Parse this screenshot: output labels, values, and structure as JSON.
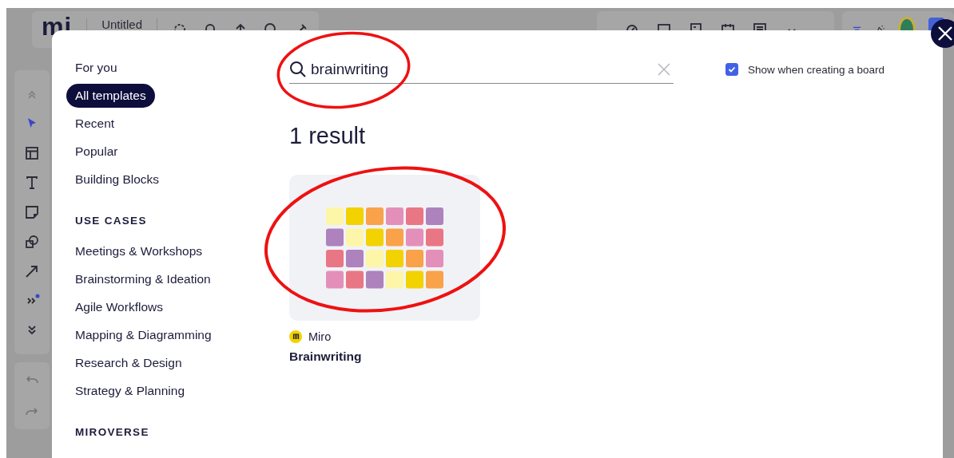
{
  "board": {
    "logo": "mi",
    "title": "Untitled"
  },
  "dialog": {
    "nav": [
      {
        "kind": "item",
        "label": "For you",
        "selected": false
      },
      {
        "kind": "item",
        "label": "All templates",
        "selected": true
      },
      {
        "kind": "item",
        "label": "Recent",
        "selected": false
      },
      {
        "kind": "item",
        "label": "Popular",
        "selected": false
      },
      {
        "kind": "item",
        "label": "Building Blocks",
        "selected": false
      },
      {
        "kind": "heading",
        "label": "USE CASES"
      },
      {
        "kind": "item",
        "label": "Meetings & Workshops",
        "selected": false
      },
      {
        "kind": "item",
        "label": "Brainstorming & Ideation",
        "selected": false
      },
      {
        "kind": "item",
        "label": "Agile Workflows",
        "selected": false
      },
      {
        "kind": "item",
        "label": "Mapping & Diagramming",
        "selected": false
      },
      {
        "kind": "item",
        "label": "Research & Design",
        "selected": false
      },
      {
        "kind": "item",
        "label": "Strategy & Planning",
        "selected": false
      },
      {
        "kind": "heading",
        "label": "MIROVERSE"
      }
    ],
    "search": {
      "value": "brainwriting"
    },
    "show_when_creating": {
      "label": "Show when creating a board",
      "checked": true
    },
    "result_count": "1 result",
    "templates": [
      {
        "author": "Miro",
        "title": "Brainwriting"
      }
    ]
  }
}
